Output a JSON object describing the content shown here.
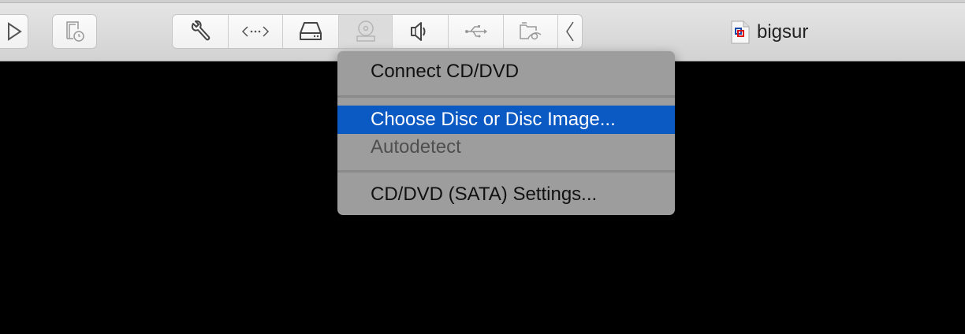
{
  "toolbar": {
    "buttons": [
      {
        "icon": "play-icon"
      },
      {
        "icon": "snapshot-icon"
      }
    ],
    "device_icons": [
      "wrench-icon",
      "network-icon",
      "hard-disk-icon",
      "cd-dvd-icon",
      "speaker-icon",
      "usb-icon",
      "shared-folder-icon",
      "chevron-left-icon"
    ]
  },
  "window": {
    "title": "bigsur"
  },
  "menu": {
    "items": [
      {
        "label": "Connect CD/DVD",
        "state": "normal"
      },
      {
        "label": "Choose Disc or Disc Image...",
        "state": "highlighted"
      },
      {
        "label": "Autodetect",
        "state": "disabled"
      },
      {
        "label": "CD/DVD (SATA) Settings...",
        "state": "normal"
      }
    ],
    "highlight_color": "#0b59c3"
  }
}
